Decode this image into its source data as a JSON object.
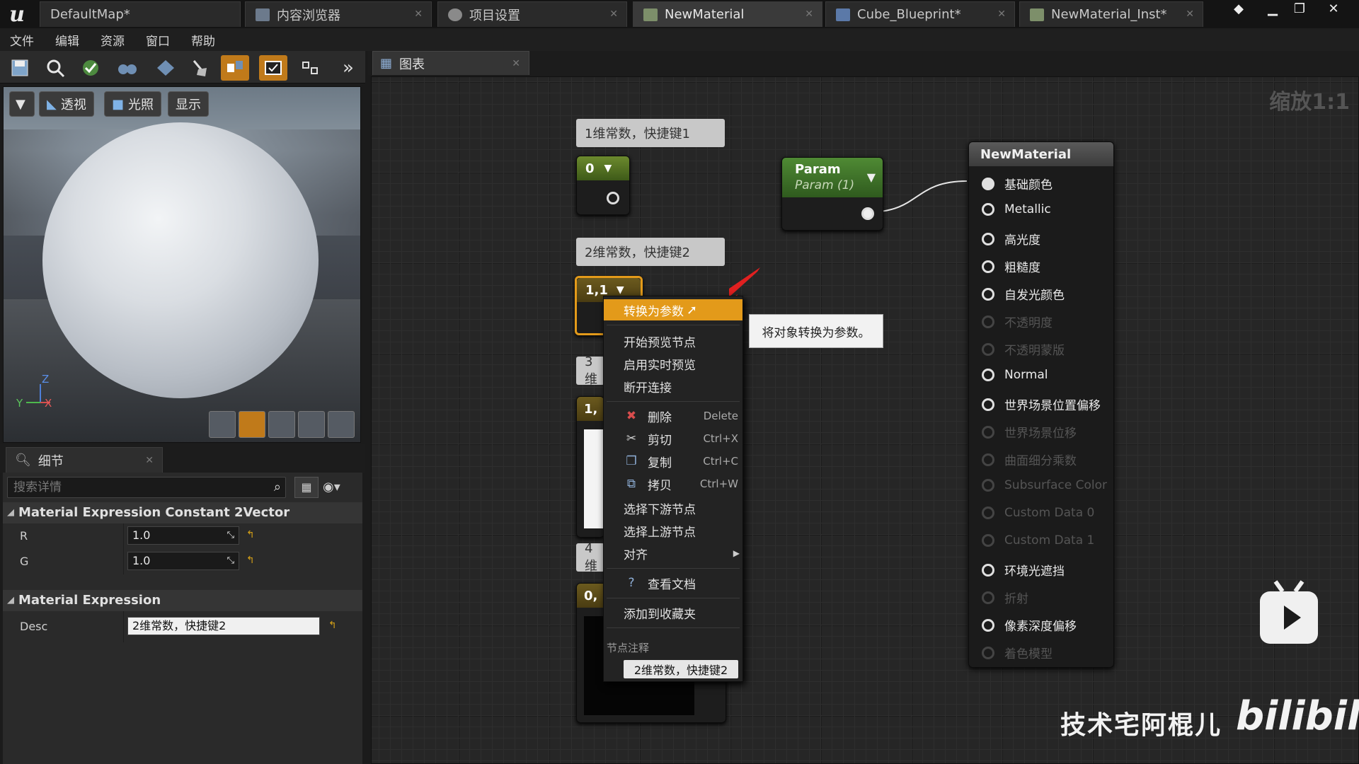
{
  "tabs": [
    {
      "label": "DefaultMap*"
    },
    {
      "label": "内容浏览器"
    },
    {
      "label": "项目设置"
    },
    {
      "label": "NewMaterial"
    },
    {
      "label": "Cube_Blueprint*"
    },
    {
      "label": "NewMaterial_Inst*"
    }
  ],
  "menu": [
    "文件",
    "编辑",
    "资源",
    "窗口",
    "帮助"
  ],
  "viewport": {
    "perspective": "透视",
    "lit": "光照",
    "show": "显示"
  },
  "axes": {
    "z": "Z",
    "y": "Y",
    "x": "X"
  },
  "details": {
    "tab": "细节",
    "search_placeholder": "搜索详情",
    "section1": "Material Expression Constant 2Vector",
    "r_label": "R",
    "r_value": "1.0",
    "g_label": "G",
    "g_value": "1.0",
    "section2": "Material Expression",
    "desc_label": "Desc",
    "desc_value": "2维常数，快捷键2"
  },
  "graph": {
    "tab": "图表",
    "zoom": "缩放1:1",
    "comment1": "1维常数，快捷键1",
    "node1_value": "0",
    "comment2": "2维常数，快捷键2",
    "node2_value": "1,1",
    "comment3_partial": "3维",
    "node3_partial": "1,",
    "comment4_partial": "4维",
    "node4_partial": "0,",
    "param_title": "Param",
    "param_subtitle": "Param (1)"
  },
  "material_node": {
    "title": "NewMaterial",
    "pins": [
      {
        "label": "基础颜色",
        "state": "connected"
      },
      {
        "label": "Metallic",
        "state": "on"
      },
      {
        "label": "高光度",
        "state": "on"
      },
      {
        "label": "粗糙度",
        "state": "on"
      },
      {
        "label": "自发光颜色",
        "state": "on"
      },
      {
        "label": "不透明度",
        "state": "dim"
      },
      {
        "label": "不透明蒙版",
        "state": "dim"
      },
      {
        "label": "Normal",
        "state": "on"
      },
      {
        "label": "世界场景位置偏移",
        "state": "on"
      },
      {
        "label": "世界场景位移",
        "state": "dim"
      },
      {
        "label": "曲面细分乘数",
        "state": "dim"
      },
      {
        "label": "Subsurface Color",
        "state": "dim"
      },
      {
        "label": "Custom Data 0",
        "state": "dim"
      },
      {
        "label": "Custom Data 1",
        "state": "dim"
      },
      {
        "label": "环境光遮挡",
        "state": "on"
      },
      {
        "label": "折射",
        "state": "dim"
      },
      {
        "label": "像素深度偏移",
        "state": "on"
      },
      {
        "label": "着色模型",
        "state": "dim"
      }
    ]
  },
  "context_menu": {
    "convert": "转换为参数",
    "start_preview": "开始预览节点",
    "realtime_preview": "启用实时预览",
    "break_links": "断开连接",
    "delete": "删除",
    "delete_sc": "Delete",
    "cut": "剪切",
    "cut_sc": "Ctrl+X",
    "copy": "复制",
    "copy_sc": "Ctrl+C",
    "duplicate": "拷贝",
    "duplicate_sc": "Ctrl+W",
    "select_downstream": "选择下游节点",
    "select_upstream": "选择上游节点",
    "align": "对齐",
    "view_docs": "查看文档",
    "add_favorites": "添加到收藏夹",
    "node_comment_section": "节点注释",
    "node_comment_value": "2维常数，快捷键2"
  },
  "tooltip": "将对象转换为参数。",
  "watermark": {
    "text": "技术宅阿棍儿",
    "logo": "bilibili"
  },
  "colors": {
    "accent": "#e39a1a",
    "param_header": "#4f8a34",
    "const_header": "#6b5a1e"
  }
}
